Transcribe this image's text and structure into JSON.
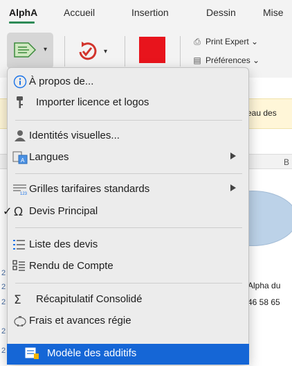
{
  "ribbon": {
    "tabs": [
      {
        "label": "AlphA",
        "active": true
      },
      {
        "label": "Accueil"
      },
      {
        "label": "Insertion"
      },
      {
        "label": "Dessin"
      },
      {
        "label": "Mise"
      }
    ],
    "small_buttons": [
      {
        "label": "Print Expert ⌄",
        "icon": "printer-icon"
      },
      {
        "label": "Préférences ⌄",
        "icon": "preferences-icon"
      }
    ],
    "accent_color": "#2e8b57",
    "red_button_color": "#e8141c"
  },
  "background": {
    "banner_text": "eau des",
    "column_letter": "B",
    "company_line1": "Alpha du",
    "company_line2": "46 58 65",
    "row_numbers": [
      "2",
      "2",
      "2",
      "2",
      "2"
    ]
  },
  "menu": {
    "items": [
      {
        "label": "À propos de...",
        "icon": "info-icon"
      },
      {
        "label": "Importer licence et logos",
        "icon": "key-icon"
      },
      {
        "label": "Identités visuelles...",
        "icon": "identity-icon"
      },
      {
        "label": "Langues",
        "icon": "languages-icon",
        "submenu": true
      },
      {
        "label": "Grilles tarifaires standards",
        "icon": "price-grid-icon",
        "submenu": true
      },
      {
        "label": "Devis Principal",
        "icon": "omega-icon",
        "checked": true
      },
      {
        "label": "Liste des devis",
        "icon": "list-icon"
      },
      {
        "label": "Rendu de Compte",
        "icon": "report-icon"
      },
      {
        "label": "Récapitulatif Consolidé",
        "icon": "sigma-icon"
      },
      {
        "label": "Frais et avances régie",
        "icon": "piggy-bank-icon"
      },
      {
        "label": "Modèle des additifs",
        "icon": "template-icon",
        "selected": true
      }
    ],
    "check_mark": "✓",
    "selection_color": "#1566d6"
  }
}
